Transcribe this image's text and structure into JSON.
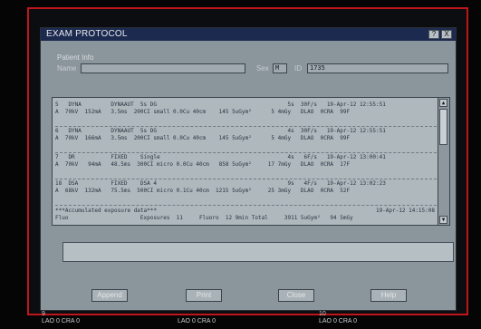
{
  "dialog": {
    "title": "EXAM PROTOCOL",
    "window_buttons": [
      "?",
      "X"
    ]
  },
  "patient_info": {
    "group_label": "Patient Info",
    "name_label": "Name",
    "name_value": "",
    "sex_label": "Sex",
    "sex_value": "M",
    "id_label": "ID",
    "id_value": "1735"
  },
  "exposure_rows": [
    {
      "line1": "5   DYNA         DYNAAUT  5s DG                                        5s  30F/s   19-Apr-12 12:55:51",
      "line2": "A  70kV  152mA   3.5ms  200CI small 0.0Cu 40cm    145 5uGym²      5 4mGy   DLAO  0CRA  99F"
    },
    {
      "line1": "6   DYNA         DYNAAUT  5s DG                                        4s  30F/s   19-Apr-12 12:55:51",
      "line2": "A  70kV  166mA   3.5ms  200CI small 0.0Cu 40cm    145 5uGym²      5 4mGy   DLAO  0CRA  99F"
    },
    {
      "line1": "7   DR           FIXED    Single                                       4s   6F/s   19-Apr-12 13:00:41",
      "line2": "A  70kV   94mA   48.5ms  300CI micro 0.0Cu 40cm   858 5uGym²     17 7mGy   DLAO  0CRA  17F"
    },
    {
      "line1": "18  DSA          FIXED    DSA 4                                        9s   4F/s   19-Apr-12 13:02:23",
      "line2": "A  68kV  132mA   75.5ms  500CI micro 0.1Cu 40cm  1215 5uGym²     25 3mGy   DLAO  0CRA  52F"
    }
  ],
  "summary": {
    "title": "***Accumulated exposure data***",
    "timestamp": "19-Apr-12 14:15:08",
    "fluoro_line": "Fluo                      Exposures  11     Fluoro  12 9min Total     3911 5uGym²   94 5mGy"
  },
  "scroll": {
    "up": "▲",
    "down": "▼"
  },
  "comment_value": "",
  "buttons": {
    "append": "Append",
    "print": "Print",
    "close": "Close",
    "help": "Help"
  },
  "bottom_labels": [
    {
      "num": "9",
      "text": "LAO 0 CRA 0"
    },
    {
      "num": "",
      "text": "LAO 0 CRA 0"
    },
    {
      "num": "10",
      "text": "LAO 0 CRA 0"
    }
  ],
  "colors": {
    "frame_border": "#c0151b",
    "titlebar": "#1d2a4f",
    "dialog_bg": "#8b959c",
    "list_bg": "#aeb8bd"
  }
}
